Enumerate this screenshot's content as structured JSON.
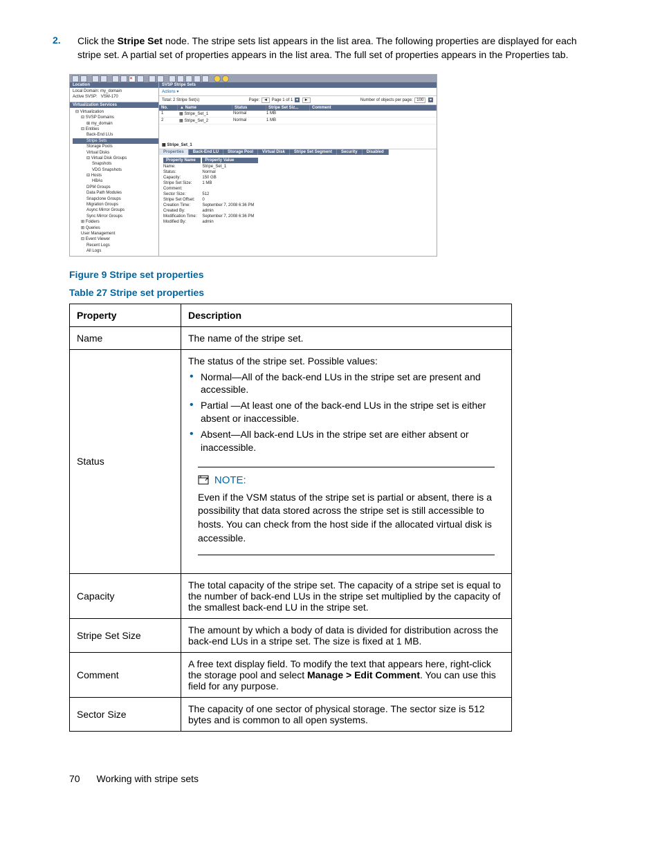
{
  "step": {
    "num": "2.",
    "text_before": "Click the ",
    "bold": "Stripe Set",
    "text_after": " node. The stripe sets list appears in the list area. The following properties are displayed for each stripe set. A partial set of properties appears in the list area. The full set of properties appears in the Properties tab."
  },
  "figure": {
    "header_right": "SVSP Stripe Sets",
    "location_label": "Location",
    "local_domain_label": "Local Domain:",
    "local_domain_value": "my_domain",
    "active_svsp_label": "Active SVSP:",
    "active_svsp_value": "VSM-170",
    "services_label": "Virtualization Services",
    "tree": [
      {
        "lvl": "t1",
        "txt": "⊟ Virtualization"
      },
      {
        "lvl": "t2",
        "txt": "⊟ SVSP Domains"
      },
      {
        "lvl": "t3",
        "txt": "⊞ my_domain"
      },
      {
        "lvl": "t2",
        "txt": "⊟ Entities"
      },
      {
        "lvl": "t3",
        "txt": "Back-End LUs"
      },
      {
        "lvl": "t3",
        "txt": "Stripe Sets",
        "sel": true
      },
      {
        "lvl": "t3",
        "txt": "Storage Pools"
      },
      {
        "lvl": "t3",
        "txt": "Virtual Disks"
      },
      {
        "lvl": "t3",
        "txt": "⊟ Virtual Disk Groups"
      },
      {
        "lvl": "t4",
        "txt": "Snapshots"
      },
      {
        "lvl": "t4",
        "txt": "VDG Snapshots"
      },
      {
        "lvl": "t3",
        "txt": "⊟ Hosts"
      },
      {
        "lvl": "t4",
        "txt": "HBAs"
      },
      {
        "lvl": "t3",
        "txt": "DPM Groups"
      },
      {
        "lvl": "t3",
        "txt": "Data Path Modules"
      },
      {
        "lvl": "t3",
        "txt": "Snapclone Groups"
      },
      {
        "lvl": "t3",
        "txt": "Migration Groups"
      },
      {
        "lvl": "t3",
        "txt": "Async Mirror Groups"
      },
      {
        "lvl": "t3",
        "txt": "Sync Mirror Groups"
      },
      {
        "lvl": "t2",
        "txt": "⊞ Folders"
      },
      {
        "lvl": "t2",
        "txt": "⊞ Queries"
      },
      {
        "lvl": "t2",
        "txt": "User Management"
      },
      {
        "lvl": "t2",
        "txt": "⊟ Event Viewer"
      },
      {
        "lvl": "t3",
        "txt": "Recent Logs"
      },
      {
        "lvl": "t3",
        "txt": "All Logs"
      }
    ],
    "actions": "Actions ▾",
    "total": "Total: 2 Stripe Set(s)",
    "page_label": "Page:",
    "page_of": "Page 1 of 1",
    "objs_label": "Number of objects per page:",
    "objs_value": "100",
    "grid": {
      "headers": [
        "No.",
        "Name",
        "Status",
        "Stripe Set Siz...",
        "Comment"
      ],
      "rows": [
        [
          "1",
          "Stripe_Set_1",
          "Normal",
          "1 MB",
          ""
        ],
        [
          "2",
          "Stripe_Set_2",
          "Normal",
          "1 MB",
          ""
        ]
      ]
    },
    "panel_title": "Stripe_Set_1",
    "tabs": [
      "Properties",
      "Back-End LU",
      "Storage Pool",
      "Virtual Disk",
      "Stripe Set Segment",
      "Security",
      "Disabled"
    ],
    "props_headers": [
      "Property Name",
      "Property Value"
    ],
    "props": [
      [
        "Name:",
        "Stripe_Set_1"
      ],
      [
        "Status:",
        "Normal"
      ],
      [
        "Capacity:",
        "150   GB"
      ],
      [
        "Stripe Set Size:",
        "1 MB"
      ],
      [
        "Comment:",
        ""
      ],
      [
        "Sector Size:",
        "512"
      ],
      [
        "Stripe Set Offset:",
        "0"
      ],
      [
        "Creation Time:",
        "September 7, 2008 6:36 PM"
      ],
      [
        "Created By:",
        "admin"
      ],
      [
        "Modification Time:",
        "September 7, 2008 6:36 PM"
      ],
      [
        "Modified By:",
        "admin"
      ]
    ]
  },
  "fig_caption": "Figure 9 Stripe set properties",
  "table_caption": "Table 27 Stripe set properties",
  "table": {
    "headers": [
      "Property",
      "Description"
    ],
    "rows": {
      "name": {
        "label": "Name",
        "desc": "The name of the stripe set."
      },
      "status": {
        "label": "Status",
        "intro": "The status of the stripe set. Possible values:",
        "bullets": [
          "Normal—All of the back-end LUs in the stripe set are present and accessible.",
          "Partial —At least one of the back-end LUs in the stripe set is either absent or inaccessible.",
          "Absent—All back-end LUs in the stripe set are either absent or inaccessible."
        ],
        "note_label": "NOTE:",
        "note_text": "Even if the VSM status of the stripe set is partial or absent, there is a possibility that data stored across the stripe set is still accessible to hosts. You can check from the host side if the allocated virtual disk is accessible."
      },
      "capacity": {
        "label": "Capacity",
        "desc": "The total capacity of the stripe set. The capacity of a stripe set is equal to the number of back-end LUs in the stripe set multiplied by the capacity of the smallest back-end LU in the stripe set."
      },
      "size": {
        "label": "Stripe Set Size",
        "desc": "The amount by which a body of data is divided for distribution across the back-end LUs in a stripe set. The size is fixed at 1 MB."
      },
      "comment": {
        "label": "Comment",
        "pre": "A free text display field. To modify the text that appears here, right-click the storage pool and select ",
        "bold": "Manage > Edit Comment",
        "post": ". You can use this field for any purpose."
      },
      "sector": {
        "label": "Sector Size",
        "desc": "The capacity of one sector of physical storage. The sector size is 512 bytes and is common to all open systems."
      }
    }
  },
  "footer": {
    "page": "70",
    "title": "Working with stripe sets"
  }
}
